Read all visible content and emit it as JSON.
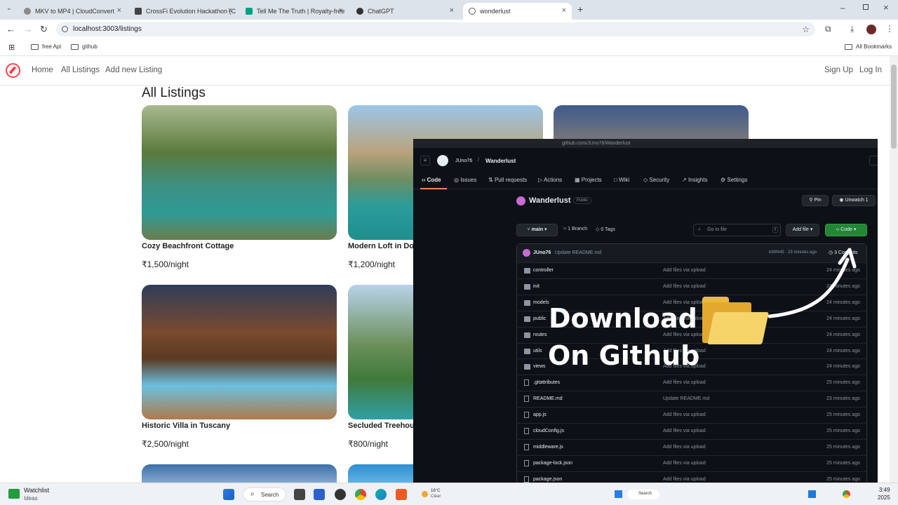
{
  "browser": {
    "tabs": [
      {
        "title": "MKV to MP4 | CloudConvert",
        "color": "#8a8a8a"
      },
      {
        "title": "CrossFi Evolution Hackathon (C",
        "color": "#444444"
      },
      {
        "title": "Tell Me The Truth | Royalty-free",
        "color": "#05a081"
      },
      {
        "title": "ChatGPT",
        "color": "#333333"
      },
      {
        "title": "wonderlust",
        "color": "#555555"
      }
    ],
    "url": "localhost:3003/listings",
    "bookmarks": [
      "free Api",
      "github"
    ],
    "all_bookmarks": "All Bookmarks"
  },
  "site": {
    "nav": {
      "home": "Home",
      "all": "All Listings",
      "add": "Add new Listing",
      "signup": "Sign Up",
      "login": "Log In"
    },
    "heading": "All Listings",
    "brand_color": "#fe424d",
    "listings": [
      {
        "title": "Cozy Beachfront Cottage",
        "price": "₹1,500/night"
      },
      {
        "title": "Modern Loft in Dow",
        "price": "₹1,200/night"
      },
      {
        "title": "Historic Villa in Tuscany",
        "price": "₹2,500/night"
      },
      {
        "title": "Secluded Treehou",
        "price": "₹800/night"
      }
    ]
  },
  "github": {
    "url": "github.com/JUno76/Wanderlust",
    "owner": "JUno76",
    "repo": "Wanderlust",
    "tabs": [
      "Code",
      "Issues",
      "Pull requests",
      "Actions",
      "Projects",
      "Wiki",
      "Security",
      "Insights",
      "Settings"
    ],
    "public_badge": "Public",
    "pin": "Pin",
    "unwatch": "Unwatch",
    "unwatch_count": "1",
    "branch": "main",
    "branches": "1 Branch",
    "tags": "0 Tags",
    "search_placeholder": "Go to file",
    "search_key": "t",
    "add_file": "Add file",
    "code_button": "Code",
    "commit": {
      "author": "JUno76",
      "message": "Update README.md",
      "meta": "b99f445 · 23 minutes ago",
      "count": "3 Commits"
    },
    "files": [
      {
        "name": "controller",
        "message": "Add files via upload",
        "time": "24 minutes ago",
        "dir": true
      },
      {
        "name": "init",
        "message": "Add files via upload",
        "time": "24 minutes ago",
        "dir": true
      },
      {
        "name": "models",
        "message": "Add files via upload",
        "time": "24 minutes ago",
        "dir": true
      },
      {
        "name": "public",
        "message": "Add files via upload",
        "time": "24 minutes ago",
        "dir": true
      },
      {
        "name": "routes",
        "message": "Add files via upload",
        "time": "24 minutes ago",
        "dir": true
      },
      {
        "name": "utils",
        "message": "Add files via upload",
        "time": "24 minutes ago",
        "dir": true
      },
      {
        "name": "views",
        "message": "Add files via upload",
        "time": "24 minutes ago",
        "dir": true
      },
      {
        "name": ".gitattributes",
        "message": "Add files via upload",
        "time": "25 minutes ago",
        "dir": false
      },
      {
        "name": "README.md",
        "message": "Update README.md",
        "time": "23 minutes ago",
        "dir": false
      },
      {
        "name": "app.js",
        "message": "Add files via upload",
        "time": "25 minutes ago",
        "dir": false
      },
      {
        "name": "cloudConfig.js",
        "message": "Add files via upload",
        "time": "25 minutes ago",
        "dir": false
      },
      {
        "name": "middleware.js",
        "message": "Add files via upload",
        "time": "25 minutes ago",
        "dir": false
      },
      {
        "name": "package-lock.json",
        "message": "Add files via upload",
        "time": "25 minutes ago",
        "dir": false
      },
      {
        "name": "package.json",
        "message": "Add files via upload",
        "time": "25 minutes ago",
        "dir": false
      }
    ]
  },
  "overlay": {
    "line1": "Download",
    "line2": "On Github"
  },
  "taskbar": {
    "watchlist": "Watchlist",
    "watchlist_sub": "Ideas",
    "search": "Search",
    "weather_temp": "16°C",
    "weather": "Clear",
    "search2": "Search",
    "time": "3:49",
    "year": "2025"
  }
}
